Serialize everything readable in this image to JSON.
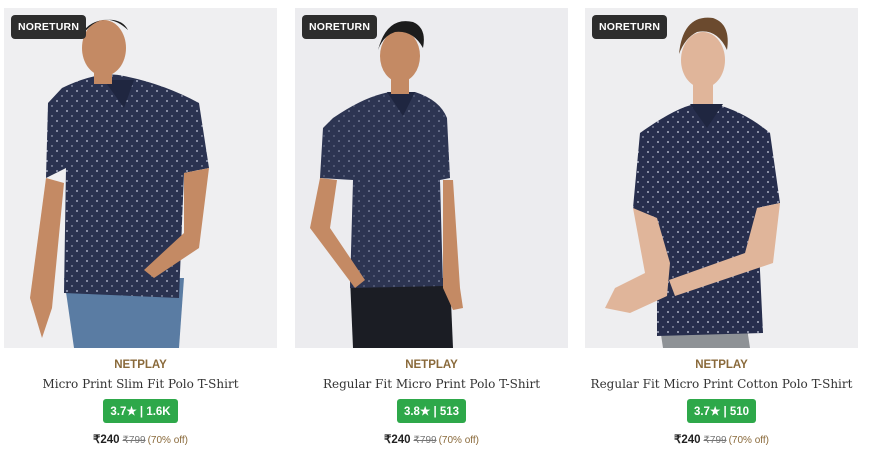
{
  "products": [
    {
      "badge": "NORETURN",
      "brand": "NETPLAY",
      "name": "Micro Print Slim Fit Polo T-Shirt",
      "rating": "3.7",
      "reviews": "1.6K",
      "price": "₹240",
      "mrp": "₹799",
      "discount": "(70% off)"
    },
    {
      "badge": "NORETURN",
      "brand": "NETPLAY",
      "name": "Regular Fit Micro Print Polo T-Shirt",
      "rating": "3.8",
      "reviews": "513",
      "price": "₹240",
      "mrp": "₹799",
      "discount": "(70% off)"
    },
    {
      "badge": "NORETURN",
      "brand": "NETPLAY",
      "name": "Regular Fit Micro Print Cotton Polo T-Shirt",
      "rating": "3.7",
      "reviews": "510",
      "price": "₹240",
      "mrp": "₹799",
      "discount": "(70% off)"
    }
  ],
  "rating_star": "★",
  "rating_separator": "|",
  "colors": {
    "rating_bg": "#2ea84a",
    "brand": "#8a6a3b",
    "badge_bg": "#2d2d2d",
    "shirt": "#2a3250"
  }
}
